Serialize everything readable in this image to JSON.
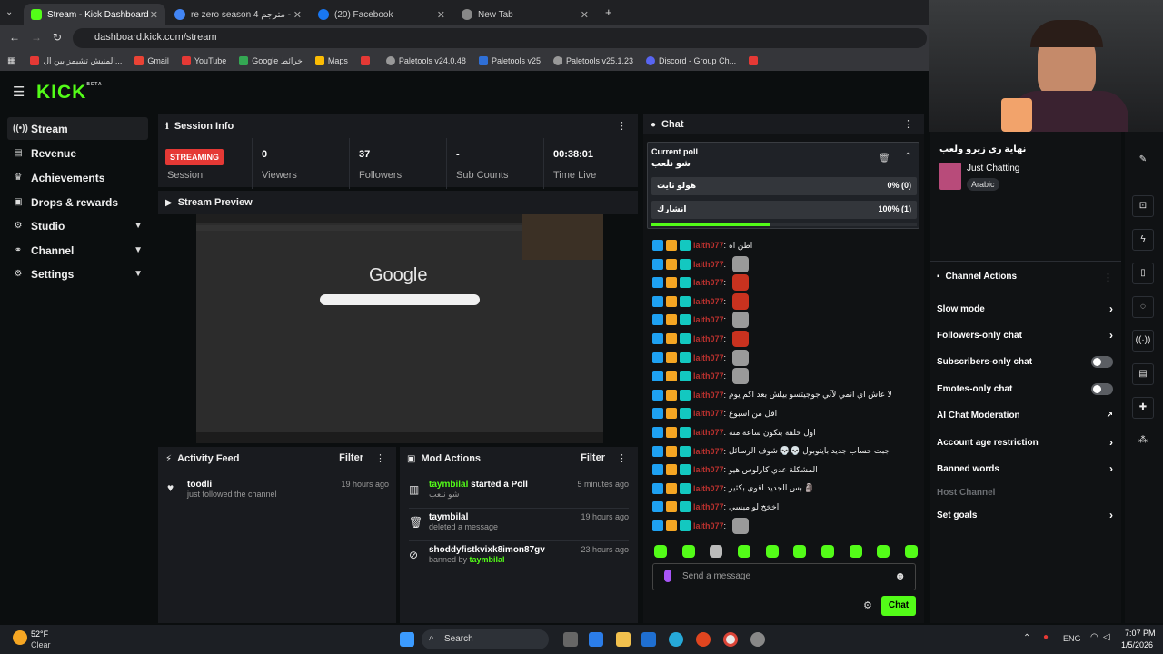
{
  "browser": {
    "tabs": [
      {
        "label": "Stream - Kick Dashboard",
        "active": true
      },
      {
        "label": "re zero season 4 مترجم - Google"
      },
      {
        "label": "(20) Facebook"
      },
      {
        "label": "New Tab"
      }
    ],
    "url": "dashboard.kick.com/stream",
    "bookmarks": [
      "المنيش تشيمز بين ال...",
      "Gmail",
      "YouTube",
      "Google خرائط",
      "Maps",
      "",
      "Paletools v24.0.48",
      "Paletools v25",
      "Paletools v25.1.23",
      "Discord - Group Ch...",
      ""
    ]
  },
  "kick": {
    "logo": "KICK",
    "beta": "BETA"
  },
  "sidebar": {
    "items": [
      {
        "label": "Stream",
        "icon": "broadcast-icon",
        "active": true
      },
      {
        "label": "Revenue",
        "icon": "revenue-icon"
      },
      {
        "label": "Achievements",
        "icon": "trophy-icon"
      },
      {
        "label": "Drops & rewards",
        "icon": "gift-icon"
      },
      {
        "label": "Studio",
        "icon": "gear-icon",
        "expandable": true
      },
      {
        "label": "Channel",
        "icon": "share-icon",
        "expandable": true
      },
      {
        "label": "Settings",
        "icon": "gear-icon",
        "expandable": true
      }
    ]
  },
  "session": {
    "title": "Session Info",
    "status_badge": "STREAMING",
    "status_label": "Session",
    "stats": [
      {
        "value": "0",
        "label": "Viewers"
      },
      {
        "value": "37",
        "label": "Followers"
      },
      {
        "value": "-",
        "label": "Sub Counts"
      },
      {
        "value": "00:38:01",
        "label": "Time Live"
      }
    ]
  },
  "preview": {
    "title": "Stream Preview",
    "inner_logo": "Google"
  },
  "activity": {
    "title": "Activity Feed",
    "filter": "Filter",
    "items": [
      {
        "name": "toodli",
        "desc": "just followed the channel",
        "time": "19 hours ago"
      }
    ]
  },
  "mod": {
    "title": "Mod Actions",
    "filter": "Filter",
    "items": [
      {
        "name": "taymbilal",
        "action": " started a Poll",
        "desc": "شو نلعب",
        "time": "5 minutes ago",
        "icon": "poll-icon"
      },
      {
        "name": "taymbilal",
        "action": "",
        "desc": "deleted a message",
        "time": "19 hours ago",
        "icon": "trash-icon"
      },
      {
        "name": "shoddyfistkvixk8imon87gv",
        "action": "",
        "desc_prefix": "banned by ",
        "desc_user": "taymbilal",
        "time": "23 hours ago",
        "icon": "ban-icon"
      }
    ]
  },
  "chat": {
    "title": "Chat",
    "poll": {
      "label": "Current poll",
      "question": "شو نلعب",
      "options": [
        {
          "text": "هولو نايت",
          "result": "0% (0)"
        },
        {
          "text": "انشارك",
          "result": "100% (1)"
        }
      ],
      "progress": 0.45
    },
    "username": "laith077",
    "messages": [
      {
        "text": "اطن اه",
        "emote": null
      },
      {
        "text": "",
        "emote": "cat"
      },
      {
        "text": "",
        "emote": "red"
      },
      {
        "text": "",
        "emote": "red"
      },
      {
        "text": "",
        "emote": "cat"
      },
      {
        "text": "",
        "emote": "red"
      },
      {
        "text": "",
        "emote": "cat"
      },
      {
        "text": "",
        "emote": "cat"
      },
      {
        "text": "لا عاش اي انمي لآني جوجيتسو بيلش بعد اكم يوم",
        "emote": null
      },
      {
        "text": "اقل من اسبوع",
        "emote": null
      },
      {
        "text": "اول حلقة بتكون ساعة منه",
        "emote": null
      },
      {
        "text": "جبت حساب جديد بايتوبول 💀💀 شوف الرسائل",
        "emote": null
      },
      {
        "text": "المشكلة عدي كارلوس هيو",
        "emote": null
      },
      {
        "text": "بس الجديد اقوى بكثير 🗿",
        "emote": null
      },
      {
        "text": "اخخخ لو ميسي",
        "emote": null
      },
      {
        "text": "",
        "emote": "cat"
      }
    ],
    "composer_placeholder": "Send a message",
    "send_label": "Chat"
  },
  "stream_info": {
    "title": "نهاية ري زيرو ولعب",
    "category": "Just Chatting",
    "tag": "Arabic"
  },
  "channel_actions": {
    "title": "Channel Actions",
    "items": [
      {
        "label": "Slow mode",
        "kind": "arrow"
      },
      {
        "label": "Followers-only chat",
        "kind": "arrow"
      },
      {
        "label": "Subscribers-only chat",
        "kind": "toggle"
      },
      {
        "label": "Emotes-only chat",
        "kind": "toggle"
      },
      {
        "label": "AI Chat Moderation",
        "kind": "external"
      },
      {
        "label": "Account age restriction",
        "kind": "arrow"
      },
      {
        "label": "Banned words",
        "kind": "arrow"
      },
      {
        "label": "Host Channel",
        "kind": "disabled"
      },
      {
        "label": "Set goals",
        "kind": "arrow"
      }
    ]
  },
  "taskbar": {
    "weather_temp": "52°F",
    "weather_desc": "Clear",
    "search": "Search",
    "lang": "ENG",
    "time": "7:07 PM",
    "date": "1/5/2026"
  },
  "colors": {
    "brand": "#53fc18",
    "live": "#e53935",
    "username": "#e53935"
  }
}
